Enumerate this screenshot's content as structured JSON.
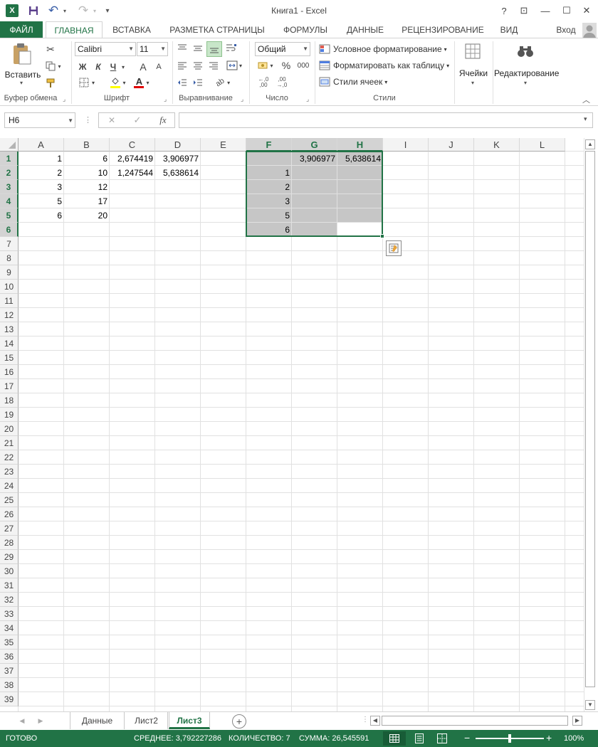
{
  "window": {
    "title": "Книга1 - Excel",
    "signin": "Вход",
    "help": "?",
    "ribbon_opts": "⊡",
    "minimize": "—",
    "maximize": "☐",
    "close": "✕"
  },
  "qat": {
    "excel_icon": "excel-logo",
    "save_icon": "save-icon",
    "undo": "↶",
    "redo": "↷",
    "customize": "⁼"
  },
  "tabs": [
    {
      "label": "ФАЙЛ"
    },
    {
      "label": "ГЛАВНАЯ"
    },
    {
      "label": "ВСТАВКА"
    },
    {
      "label": "РАЗМЕТКА СТРАНИЦЫ"
    },
    {
      "label": "ФОРМУЛЫ"
    },
    {
      "label": "ДАННЫЕ"
    },
    {
      "label": "РЕЦЕНЗИРОВАНИЕ"
    },
    {
      "label": "ВИД"
    }
  ],
  "ribbon": {
    "clipboard": {
      "paste": "Вставить",
      "label": "Буфер обмена"
    },
    "font": {
      "name": "Calibri",
      "size": "11",
      "bold": "Ж",
      "italic": "К",
      "underline": "Ч",
      "grow": "A",
      "shrink": "A",
      "label": "Шрифт"
    },
    "alignment": {
      "label": "Выравнивание"
    },
    "number": {
      "format": "Общий",
      "percent": "%",
      "thousands": "000",
      "label": "Число"
    },
    "styles": {
      "conditional": "Условное форматирование",
      "as_table": "Форматировать как таблицу",
      "cell_styles": "Стили ячеек",
      "label": "Стили"
    },
    "cells": {
      "label": "Ячейки"
    },
    "editing": {
      "label": "Редактирование"
    }
  },
  "formula_bar": {
    "name_box": "H6",
    "fx": "fx",
    "cancel": "✕",
    "enter": "✓",
    "formula": ""
  },
  "grid": {
    "columns": [
      "A",
      "B",
      "C",
      "D",
      "E",
      "F",
      "G",
      "H",
      "I",
      "J",
      "K",
      "L"
    ],
    "selected_columns": [
      "F",
      "G",
      "H"
    ],
    "rows": [
      "1",
      "2",
      "3",
      "4",
      "5",
      "6",
      "7",
      "8",
      "9",
      "10",
      "11",
      "12",
      "13",
      "14",
      "15",
      "16",
      "17",
      "18",
      "19",
      "20",
      "21",
      "22",
      "23",
      "24",
      "25",
      "26",
      "27",
      "28",
      "29",
      "30",
      "31",
      "32",
      "33",
      "34",
      "35",
      "36",
      "37",
      "38",
      "39"
    ],
    "selected_rows": [
      "1",
      "2",
      "3",
      "4",
      "5",
      "6"
    ],
    "cells": {
      "A1": "1",
      "B1": "6",
      "C1": "2,674419",
      "D1": "3,906977",
      "A2": "2",
      "B2": "10",
      "C2": "1,247544",
      "D2": "5,638614",
      "A3": "3",
      "B3": "12",
      "A4": "5",
      "B4": "17",
      "A5": "6",
      "B5": "20",
      "G1": "3,906977",
      "H1": "5,638614",
      "F2": "1",
      "F3": "2",
      "F4": "3",
      "F5": "5",
      "F6": "6"
    },
    "active_cell": "H6",
    "selection": "F1:H6"
  },
  "sheets": {
    "tabs": [
      "Данные",
      "Лист2",
      "Лист3"
    ],
    "active": "Лист3",
    "add": "+"
  },
  "status": {
    "ready": "ГОТОВО",
    "average": "СРЕДНЕЕ: 3,792227286",
    "count": "КОЛИЧЕСТВО: 7",
    "sum": "СУММА: 26,545591",
    "zoom": "100%",
    "zoom_level": 1.0
  },
  "colors": {
    "accent": "#217346",
    "selection_fill": "#c6c6c6",
    "selected_header": "#d3d3d3"
  }
}
